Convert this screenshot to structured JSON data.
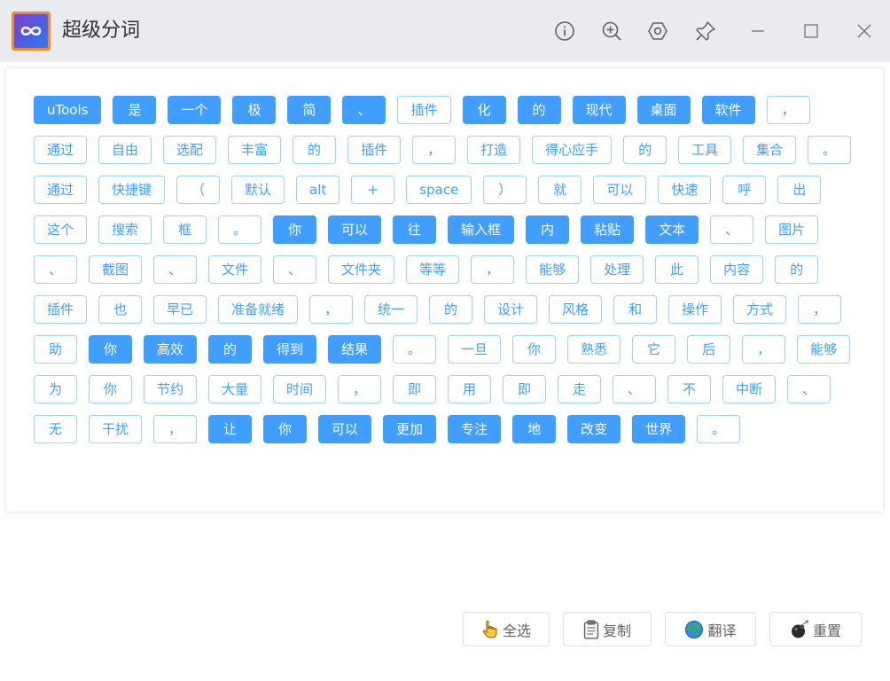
{
  "app": {
    "title": "超级分词",
    "accent": "#409eff",
    "icons": [
      "info-icon",
      "zoom-in-icon",
      "hexagon-settings-icon",
      "pin-icon",
      "minimize-icon",
      "maximize-icon",
      "close-icon"
    ]
  },
  "words": [
    {
      "t": "uTools",
      "s": true
    },
    {
      "t": "是",
      "s": true
    },
    {
      "t": "一个",
      "s": true
    },
    {
      "t": "极",
      "s": true
    },
    {
      "t": "简",
      "s": true
    },
    {
      "t": "、",
      "s": true
    },
    {
      "t": "插件",
      "s": false
    },
    {
      "t": "化",
      "s": true
    },
    {
      "t": "的",
      "s": true
    },
    {
      "t": "现代",
      "s": true
    },
    {
      "t": "桌面",
      "s": true
    },
    {
      "t": "软件",
      "s": true
    },
    {
      "t": "，",
      "s": false
    },
    {
      "t": "通过",
      "s": false
    },
    {
      "t": "自由",
      "s": false
    },
    {
      "t": "选配",
      "s": false
    },
    {
      "t": "丰富",
      "s": false
    },
    {
      "t": "的",
      "s": false
    },
    {
      "t": "插件",
      "s": false
    },
    {
      "t": "，",
      "s": false
    },
    {
      "t": "打造",
      "s": false
    },
    {
      "t": "得心应手",
      "s": false
    },
    {
      "t": "的",
      "s": false
    },
    {
      "t": "工具",
      "s": false
    },
    {
      "t": "集合",
      "s": false
    },
    {
      "t": "。",
      "s": false
    },
    {
      "t": "通过",
      "s": false
    },
    {
      "t": "快捷键",
      "s": false
    },
    {
      "t": "（",
      "s": false
    },
    {
      "t": "默认",
      "s": false
    },
    {
      "t": "alt",
      "s": false
    },
    {
      "t": "+",
      "s": false
    },
    {
      "t": "space",
      "s": false
    },
    {
      "t": "）",
      "s": false
    },
    {
      "t": "就",
      "s": false
    },
    {
      "t": "可以",
      "s": false
    },
    {
      "t": "快速",
      "s": false
    },
    {
      "t": "呼",
      "s": false
    },
    {
      "t": "出",
      "s": false
    },
    {
      "t": "这个",
      "s": false
    },
    {
      "t": "搜索",
      "s": false
    },
    {
      "t": "框",
      "s": false
    },
    {
      "t": "。",
      "s": false
    },
    {
      "t": "你",
      "s": true
    },
    {
      "t": "可以",
      "s": true
    },
    {
      "t": "往",
      "s": true
    },
    {
      "t": "输入框",
      "s": true
    },
    {
      "t": "内",
      "s": true
    },
    {
      "t": "粘贴",
      "s": true
    },
    {
      "t": "文本",
      "s": true
    },
    {
      "t": "、",
      "s": false
    },
    {
      "t": "图片",
      "s": false
    },
    {
      "t": "、",
      "s": false
    },
    {
      "t": "截图",
      "s": false
    },
    {
      "t": "、",
      "s": false
    },
    {
      "t": "文件",
      "s": false
    },
    {
      "t": "、",
      "s": false
    },
    {
      "t": "文件夹",
      "s": false
    },
    {
      "t": "等等",
      "s": false
    },
    {
      "t": "，",
      "s": false
    },
    {
      "t": "能够",
      "s": false
    },
    {
      "t": "处理",
      "s": false
    },
    {
      "t": "此",
      "s": false
    },
    {
      "t": "内容",
      "s": false
    },
    {
      "t": "的",
      "s": false
    },
    {
      "t": "插件",
      "s": false
    },
    {
      "t": "也",
      "s": false
    },
    {
      "t": "早已",
      "s": false
    },
    {
      "t": "准备就绪",
      "s": false
    },
    {
      "t": "，",
      "s": false
    },
    {
      "t": "统一",
      "s": false
    },
    {
      "t": "的",
      "s": false
    },
    {
      "t": "设计",
      "s": false
    },
    {
      "t": "风格",
      "s": false
    },
    {
      "t": "和",
      "s": false
    },
    {
      "t": "操作",
      "s": false
    },
    {
      "t": "方式",
      "s": false
    },
    {
      "t": "，",
      "s": false
    },
    {
      "t": "助",
      "s": false
    },
    {
      "t": "你",
      "s": true
    },
    {
      "t": "高效",
      "s": true
    },
    {
      "t": "的",
      "s": true
    },
    {
      "t": "得到",
      "s": true
    },
    {
      "t": "结果",
      "s": true
    },
    {
      "t": "。",
      "s": false
    },
    {
      "t": "一旦",
      "s": false
    },
    {
      "t": "你",
      "s": false
    },
    {
      "t": "熟悉",
      "s": false
    },
    {
      "t": "它",
      "s": false
    },
    {
      "t": "后",
      "s": false
    },
    {
      "t": "，",
      "s": false
    },
    {
      "t": "能够",
      "s": false
    },
    {
      "t": "为",
      "s": false
    },
    {
      "t": "你",
      "s": false
    },
    {
      "t": "节约",
      "s": false
    },
    {
      "t": "大量",
      "s": false
    },
    {
      "t": "时间",
      "s": false
    },
    {
      "t": "，",
      "s": false
    },
    {
      "t": "即",
      "s": false
    },
    {
      "t": "用",
      "s": false
    },
    {
      "t": "即",
      "s": false
    },
    {
      "t": "走",
      "s": false
    },
    {
      "t": "、",
      "s": false
    },
    {
      "t": "不",
      "s": false
    },
    {
      "t": "中断",
      "s": false
    },
    {
      "t": "、",
      "s": false
    },
    {
      "t": "无",
      "s": false
    },
    {
      "t": "干扰",
      "s": false
    },
    {
      "t": "，",
      "s": false
    },
    {
      "t": "让",
      "s": true
    },
    {
      "t": "你",
      "s": true
    },
    {
      "t": "可以",
      "s": true
    },
    {
      "t": "更加",
      "s": true
    },
    {
      "t": "专注",
      "s": true
    },
    {
      "t": "地",
      "s": true
    },
    {
      "t": "改变",
      "s": true
    },
    {
      "t": "世界",
      "s": true
    },
    {
      "t": "。",
      "s": false
    }
  ],
  "actions": {
    "select_all": "全选",
    "copy": "复制",
    "translate": "翻译",
    "reset": "重置"
  }
}
